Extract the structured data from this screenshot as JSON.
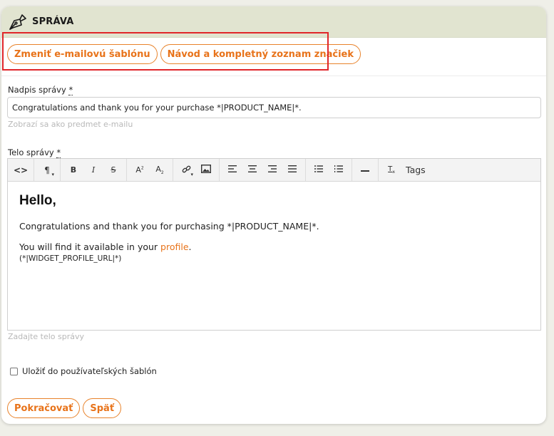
{
  "header": {
    "title": "SPRÁVA",
    "icon": "pen-nib-icon"
  },
  "actions": {
    "change_template": "Zmeniť e-mailovú šablónu",
    "guide": "Návod a kompletný zoznam značiek"
  },
  "subject": {
    "label": "Nadpis správy",
    "required_mark": "*",
    "value": "Congratulations and thank you for your purchase *|PRODUCT_NAME|*.",
    "hint": "Zobrazí sa ako predmet e-mailu"
  },
  "body": {
    "label": "Telo správy",
    "required_mark": "*",
    "toolbar": {
      "source": "<>",
      "paragraph": "¶",
      "bold": "B",
      "italic": "I",
      "strike": "S",
      "superscript": "A",
      "subscript": "A",
      "tags": "Tags"
    },
    "content": {
      "heading": "Hello,",
      "line1": "Congratulations and thank you for purchasing *|PRODUCT_NAME|*.",
      "line2_prefix": "You will find it available in your ",
      "line2_link": "profile",
      "line2_suffix": ".",
      "line3": "(*|WIDGET_PROFILE_URL|*)"
    },
    "hint": "Zadajte telo správy"
  },
  "save_template": {
    "label": "Uložiť do používateľských šablón",
    "checked": false
  },
  "footer": {
    "continue": "Pokračovať",
    "back": "Späť"
  },
  "colors": {
    "accent": "#e8731a",
    "header_bg": "#e1e4d0",
    "highlight": "#e0262a"
  }
}
